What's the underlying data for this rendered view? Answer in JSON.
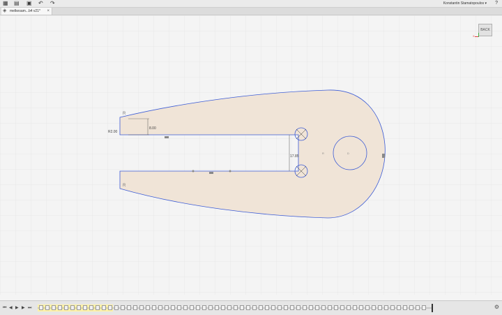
{
  "toolbar": {
    "icons": {
      "grid": "grid-icon",
      "file": "file-icon",
      "save": "save-icon",
      "undo": "undo-icon",
      "redo": "redo-icon"
    },
    "user_name": "Konstantin Stamatopoulos ▾",
    "help_glyph": "?"
  },
  "tab": {
    "label": "melkesam...b4 v21*",
    "close": "×"
  },
  "viewcube": {
    "label": "BACK",
    "axis_x": "X"
  },
  "sketch": {
    "fill_color": "#f0e4d7",
    "line_color": "#3b5bd6",
    "dimensions": {
      "d1": "8.00",
      "d2": "17.85",
      "d3": "R2.00"
    },
    "labels": {
      "hole": "R",
      "center": "D",
      "slot": "R"
    }
  },
  "timeline": {
    "buttons": [
      "⏮",
      "◀",
      "▶",
      "▶",
      "⏭"
    ],
    "gear": "⚙"
  }
}
